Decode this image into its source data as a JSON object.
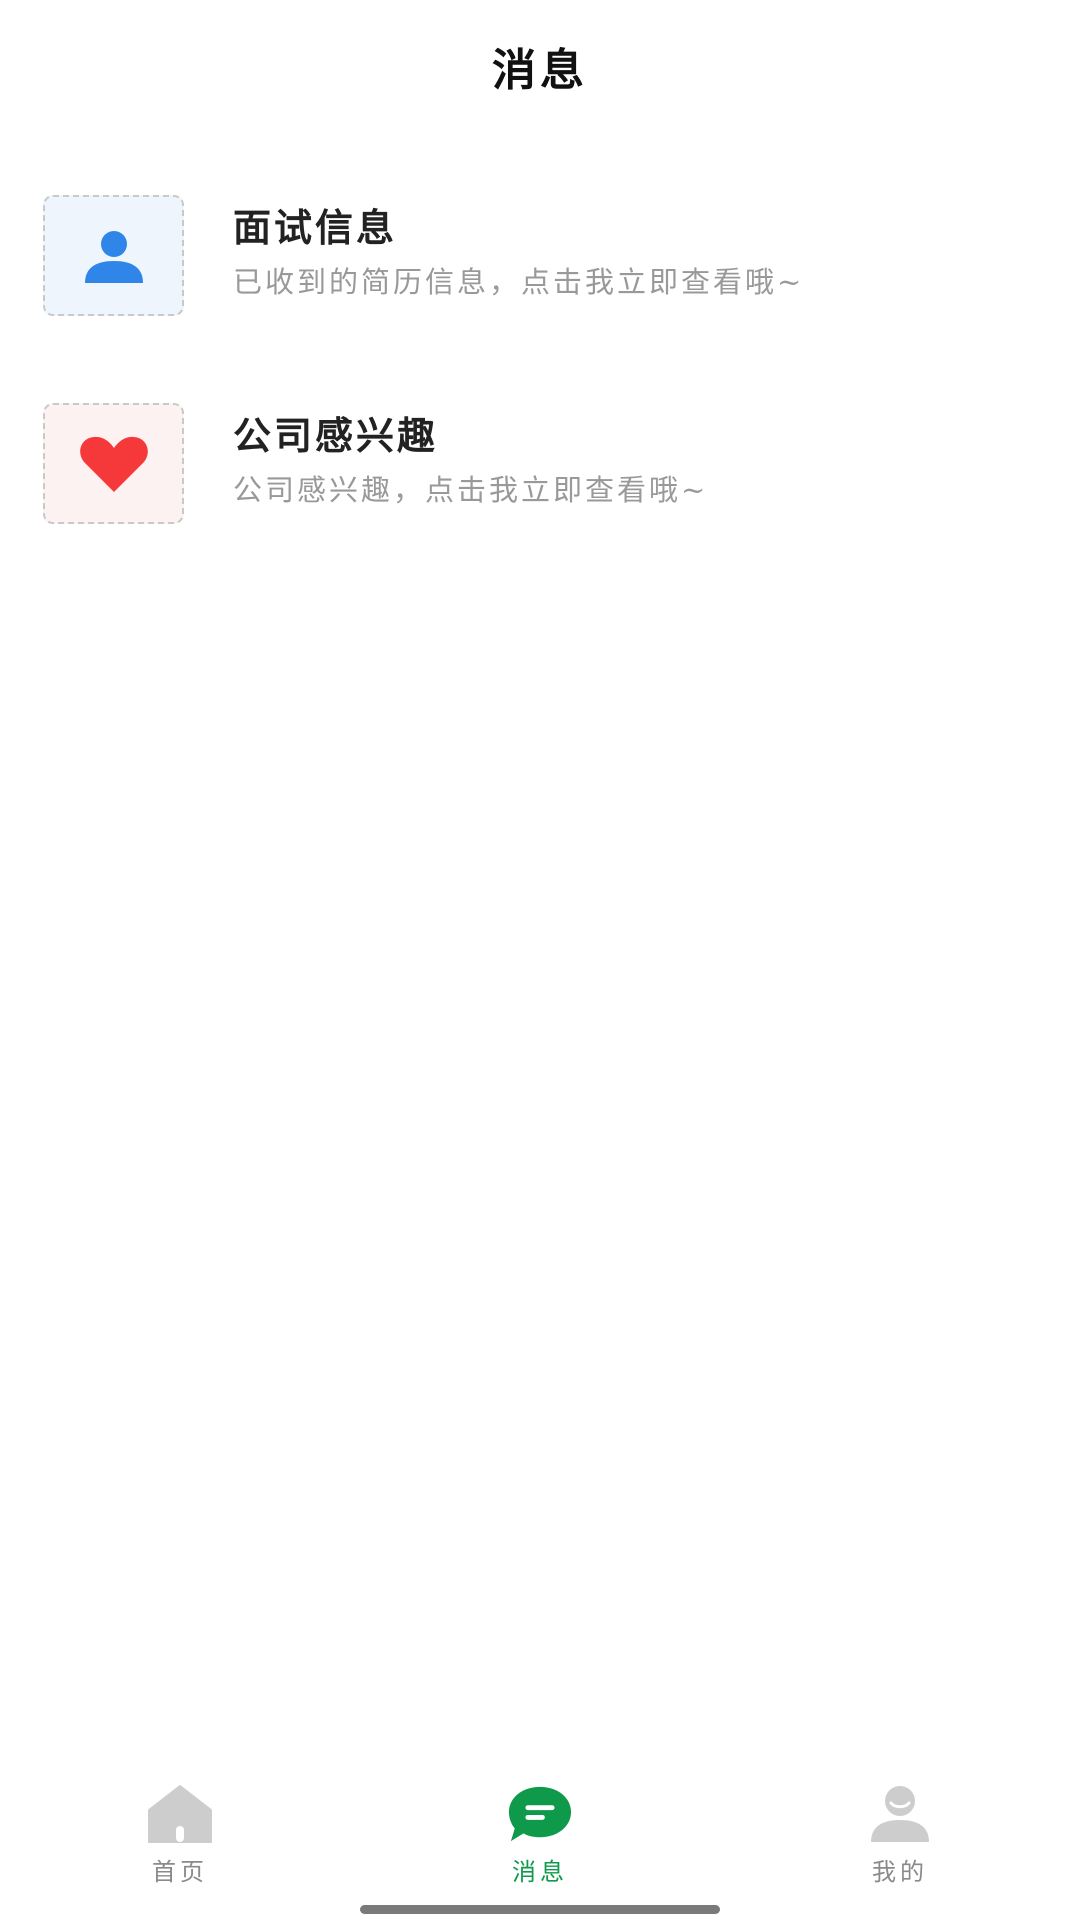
{
  "header": {
    "title": "消息"
  },
  "messages": [
    {
      "icon": "person-icon",
      "title": "面试信息",
      "subtitle": "已收到的简历信息，点击我立即查看哦~",
      "accent_color": "#2f86e8"
    },
    {
      "icon": "heart-icon",
      "title": "公司感兴趣",
      "subtitle": "公司感兴趣，点击我立即查看哦~",
      "accent_color": "#f5393a"
    }
  ],
  "tabbar": {
    "tabs": [
      {
        "label": "首页",
        "icon": "home-icon",
        "active": false
      },
      {
        "label": "消息",
        "icon": "chat-icon",
        "active": true
      },
      {
        "label": "我的",
        "icon": "user-icon",
        "active": false
      }
    ],
    "active_color": "#0e9a4a",
    "inactive_color": "#8a8a8a"
  }
}
